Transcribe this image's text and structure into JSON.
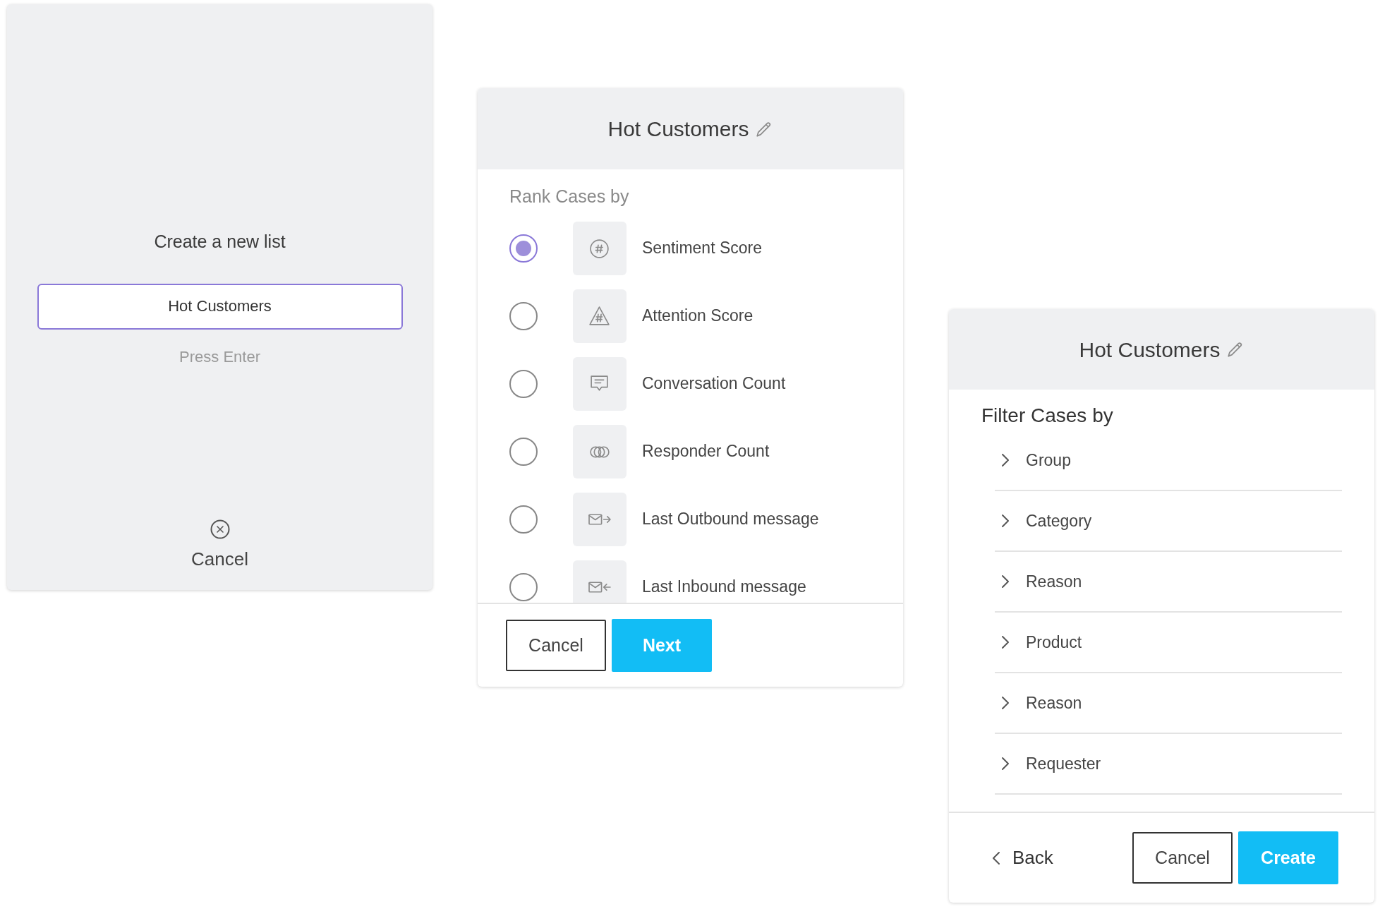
{
  "create_panel": {
    "title": "Create a new list",
    "name_field": {
      "value": "Hot Customers",
      "focused": true
    },
    "hint": "Press Enter",
    "cancel": "Cancel"
  },
  "rank_panel": {
    "title": "Hot Customers",
    "subtitle": "Rank Cases by",
    "options": [
      {
        "label": "Sentiment Score",
        "selected": true
      },
      {
        "label": "Attention Score",
        "selected": false
      },
      {
        "label": "Conversation Count",
        "selected": false
      },
      {
        "label": "Responder Count",
        "selected": false
      },
      {
        "label": "Last Outbound message",
        "selected": false
      },
      {
        "label": "Last Inbound message",
        "selected": false
      }
    ],
    "buttons": [
      {
        "label": "Cancel",
        "kind": "outline"
      },
      {
        "label": "Next",
        "kind": "primary"
      }
    ]
  },
  "filter_panel": {
    "title": "Hot Customers",
    "subtitle": "Filter Cases by",
    "filters": [
      {
        "label": "Group"
      },
      {
        "label": "Category"
      },
      {
        "label": "Reason"
      },
      {
        "label": "Product"
      },
      {
        "label": "Reason"
      },
      {
        "label": "Requester"
      }
    ],
    "back": "Back",
    "buttons": [
      {
        "label": "Cancel",
        "kind": "outline"
      },
      {
        "label": "Create",
        "kind": "primary"
      }
    ]
  }
}
